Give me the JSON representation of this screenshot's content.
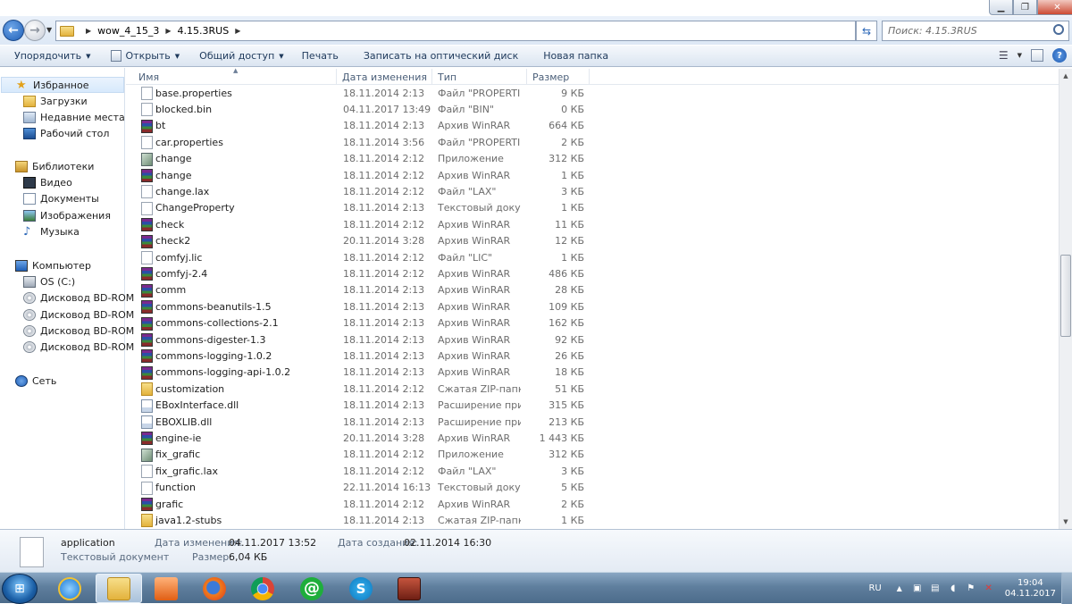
{
  "address": {
    "crumbs": [
      "wow_4_15_3",
      "4.15.3RUS"
    ],
    "search_placeholder": "Поиск: 4.15.3RUS"
  },
  "toolbar": {
    "organize": "Упорядочить",
    "open": "Открыть",
    "share": "Общий доступ",
    "print": "Печать",
    "burn": "Записать на оптический диск",
    "new_folder": "Новая папка"
  },
  "nav": {
    "favorites": "Избранное",
    "downloads": "Загрузки",
    "recent": "Недавние места",
    "desktop": "Рабочий стол",
    "libraries": "Библиотеки",
    "video": "Видео",
    "documents": "Документы",
    "pictures": "Изображения",
    "music": "Музыка",
    "computer": "Компьютер",
    "os": "OS (C:)",
    "bd1": "Дисковод BD-ROM",
    "bd2": "Дисковод BD-ROM",
    "bd3": "Дисковод BD-ROM",
    "bd4": "Дисковод BD-ROM",
    "network": "Сеть"
  },
  "columns": {
    "name": "Имя",
    "date": "Дата изменения",
    "type": "Тип",
    "size": "Размер"
  },
  "files": [
    {
      "name": "base.properties",
      "date": "18.11.2014 2:13",
      "type": "Файл \"PROPERTIE...",
      "size": "9 КБ",
      "icon": "doc"
    },
    {
      "name": "blocked.bin",
      "date": "04.11.2017 13:49",
      "type": "Файл \"BIN\"",
      "size": "0 КБ",
      "icon": "doc"
    },
    {
      "name": "bt",
      "date": "18.11.2014 2:13",
      "type": "Архив WinRAR",
      "size": "664 КБ",
      "icon": "rar"
    },
    {
      "name": "car.properties",
      "date": "18.11.2014 3:56",
      "type": "Файл \"PROPERTIE...",
      "size": "2 КБ",
      "icon": "doc"
    },
    {
      "name": "change",
      "date": "18.11.2014 2:12",
      "type": "Приложение",
      "size": "312 КБ",
      "icon": "app"
    },
    {
      "name": "change",
      "date": "18.11.2014 2:12",
      "type": "Архив WinRAR",
      "size": "1 КБ",
      "icon": "rar"
    },
    {
      "name": "change.lax",
      "date": "18.11.2014 2:12",
      "type": "Файл \"LAX\"",
      "size": "3 КБ",
      "icon": "doc"
    },
    {
      "name": "ChangeProperty",
      "date": "18.11.2014 2:13",
      "type": "Текстовый докум...",
      "size": "1 КБ",
      "icon": "doc"
    },
    {
      "name": "check",
      "date": "18.11.2014 2:12",
      "type": "Архив WinRAR",
      "size": "11 КБ",
      "icon": "rar"
    },
    {
      "name": "check2",
      "date": "20.11.2014 3:28",
      "type": "Архив WinRAR",
      "size": "12 КБ",
      "icon": "rar"
    },
    {
      "name": "comfyj.lic",
      "date": "18.11.2014 2:12",
      "type": "Файл \"LIC\"",
      "size": "1 КБ",
      "icon": "doc"
    },
    {
      "name": "comfyj-2.4",
      "date": "18.11.2014 2:12",
      "type": "Архив WinRAR",
      "size": "486 КБ",
      "icon": "rar"
    },
    {
      "name": "comm",
      "date": "18.11.2014 2:13",
      "type": "Архив WinRAR",
      "size": "28 КБ",
      "icon": "rar"
    },
    {
      "name": "commons-beanutils-1.5",
      "date": "18.11.2014 2:13",
      "type": "Архив WinRAR",
      "size": "109 КБ",
      "icon": "rar"
    },
    {
      "name": "commons-collections-2.1",
      "date": "18.11.2014 2:13",
      "type": "Архив WinRAR",
      "size": "162 КБ",
      "icon": "rar"
    },
    {
      "name": "commons-digester-1.3",
      "date": "18.11.2014 2:13",
      "type": "Архив WinRAR",
      "size": "92 КБ",
      "icon": "rar"
    },
    {
      "name": "commons-logging-1.0.2",
      "date": "18.11.2014 2:13",
      "type": "Архив WinRAR",
      "size": "26 КБ",
      "icon": "rar"
    },
    {
      "name": "commons-logging-api-1.0.2",
      "date": "18.11.2014 2:13",
      "type": "Архив WinRAR",
      "size": "18 КБ",
      "icon": "rar"
    },
    {
      "name": "customization",
      "date": "18.11.2014 2:12",
      "type": "Сжатая ZIP-папка",
      "size": "51 КБ",
      "icon": "zip"
    },
    {
      "name": "EBoxInterface.dll",
      "date": "18.11.2014 2:13",
      "type": "Расширение при...",
      "size": "315 КБ",
      "icon": "dll"
    },
    {
      "name": "EBOXLIB.dll",
      "date": "18.11.2014 2:13",
      "type": "Расширение при...",
      "size": "213 КБ",
      "icon": "dll"
    },
    {
      "name": "engine-ie",
      "date": "20.11.2014 3:28",
      "type": "Архив WinRAR",
      "size": "1 443 КБ",
      "icon": "rar"
    },
    {
      "name": "fix_grafic",
      "date": "18.11.2014 2:12",
      "type": "Приложение",
      "size": "312 КБ",
      "icon": "app"
    },
    {
      "name": "fix_grafic.lax",
      "date": "18.11.2014 2:12",
      "type": "Файл \"LAX\"",
      "size": "3 КБ",
      "icon": "doc"
    },
    {
      "name": "function",
      "date": "22.11.2014 16:13",
      "type": "Текстовый докум...",
      "size": "5 КБ",
      "icon": "doc"
    },
    {
      "name": "grafic",
      "date": "18.11.2014 2:12",
      "type": "Архив WinRAR",
      "size": "2 КБ",
      "icon": "rar"
    },
    {
      "name": "java1.2-stubs",
      "date": "18.11.2014 2:13",
      "type": "Сжатая ZIP-папка",
      "size": "1 КБ",
      "icon": "zip"
    }
  ],
  "details": {
    "name": "application",
    "type": "Текстовый документ",
    "modified_label": "Дата изменения:",
    "modified": "04.11.2017 13:52",
    "created_label": "Дата создания:",
    "created": "02.11.2014 16:30",
    "size_label": "Размер:",
    "size": "6,04 КБ"
  },
  "tray": {
    "lang": "RU",
    "time": "19:04",
    "date": "04.11.2017"
  }
}
